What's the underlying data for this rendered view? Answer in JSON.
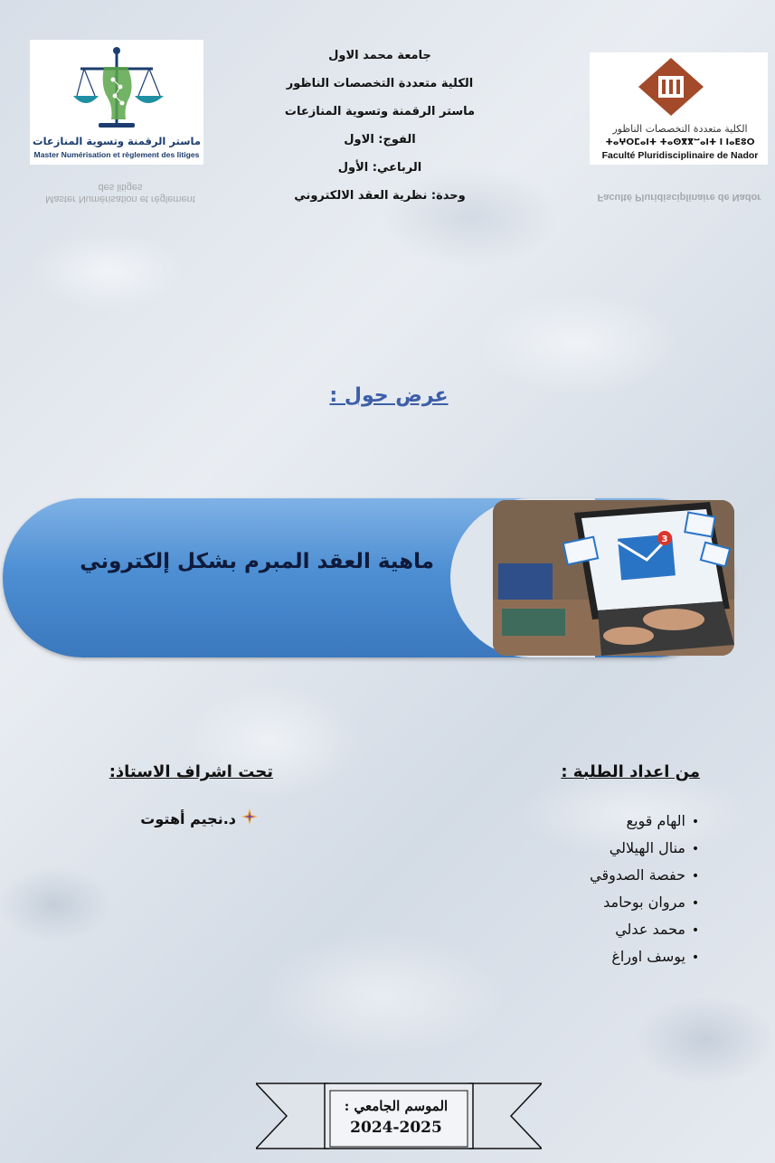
{
  "header": {
    "lines": [
      "جامعة محمد الاول",
      "الكلية متعددة التخصصات الناظور",
      "ماستر الرقمنة وتسوية المنازعات",
      "الفوج: الاول",
      "الرباعي: الأول",
      "وحدة: نظرية العقد الالكتروني"
    ]
  },
  "logo_left": {
    "title_ar": "ماستر الرقمنة وتسوية المنازعات",
    "title_fr": "Master Numérisation et règlement des litiges",
    "colors": {
      "teal": "#1f8fa3",
      "navy": "#1c3d6e",
      "green": "#5aa64a"
    }
  },
  "logo_right": {
    "title_ar": "الكلية متعددة التخصصات الناظور",
    "title_tifinagh": "ⵜⴰⵖⵔⵎⴰⵏⵜ ⵜⴰⵙⴳⴳⵯⴰⵏⵜ ⵏ ⵏⴰⴹⵓⵔ",
    "title_fr": "Faculté Pluridisciplinaire de Nador",
    "colors": {
      "brown": "#a34a2a"
    }
  },
  "presentation": {
    "label": "عرض حول :"
  },
  "banner": {
    "title": "ماهية العقد المبرم بشكل إلكتروني",
    "colors": {
      "top": "#7fb2e6",
      "bottom": "#3b78be"
    },
    "photo": {
      "badge": "3",
      "icon": "email-laptop-photo"
    }
  },
  "students": {
    "title": "من اعداد الطلبة :",
    "bullet": "•",
    "names": [
      "الهام قويع",
      "منال الهيلالي",
      "حفصة الصدوقي",
      "مروان بوحامد",
      "محمد عدلي",
      "يوسف اوراغ"
    ]
  },
  "supervisor": {
    "title": "تحت اشراف الاستاذ:",
    "name": "د.نجيم أهتوت",
    "icon": "four-point-star-icon"
  },
  "season": {
    "label": "الموسم الجامعي :",
    "years": "2024-2025"
  }
}
